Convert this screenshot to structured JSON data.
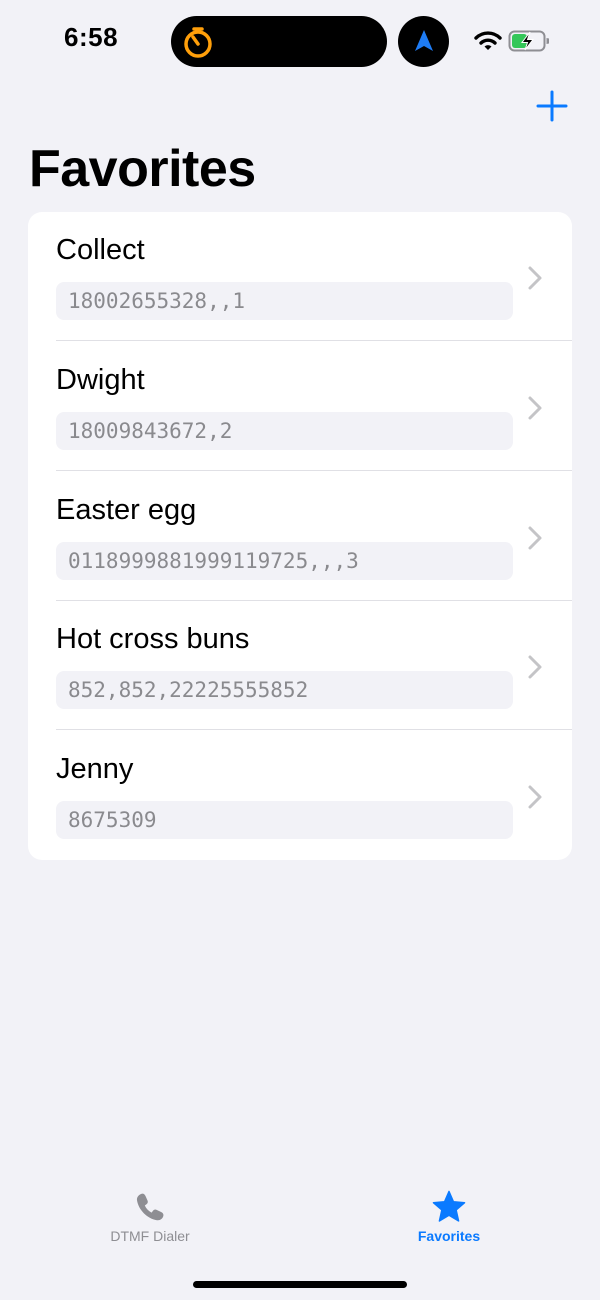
{
  "status_bar": {
    "time": "6:58",
    "icons": [
      "timer-icon",
      "location-arrow-icon",
      "wifi-icon",
      "battery-charging-icon"
    ]
  },
  "colors": {
    "accent": "#0a7aff",
    "timer": "#ff9f0a",
    "battery_fill": "#34c759",
    "background": "#f2f2f7"
  },
  "nav": {
    "title": "Favorites",
    "add_icon": "plus-icon"
  },
  "favorites": [
    {
      "name": "Collect",
      "number": "18002655328,,1"
    },
    {
      "name": "Dwight",
      "number": "18009843672,2"
    },
    {
      "name": "Easter egg",
      "number": "0118999881999119725,,,3"
    },
    {
      "name": "Hot cross buns",
      "number": "852,852,22225555852"
    },
    {
      "name": "Jenny",
      "number": "8675309"
    }
  ],
  "tab_bar": {
    "tabs": [
      {
        "label": "DTMF Dialer",
        "icon": "phone-icon",
        "selected": false
      },
      {
        "label": "Favorites",
        "icon": "star-icon",
        "selected": true
      }
    ]
  }
}
